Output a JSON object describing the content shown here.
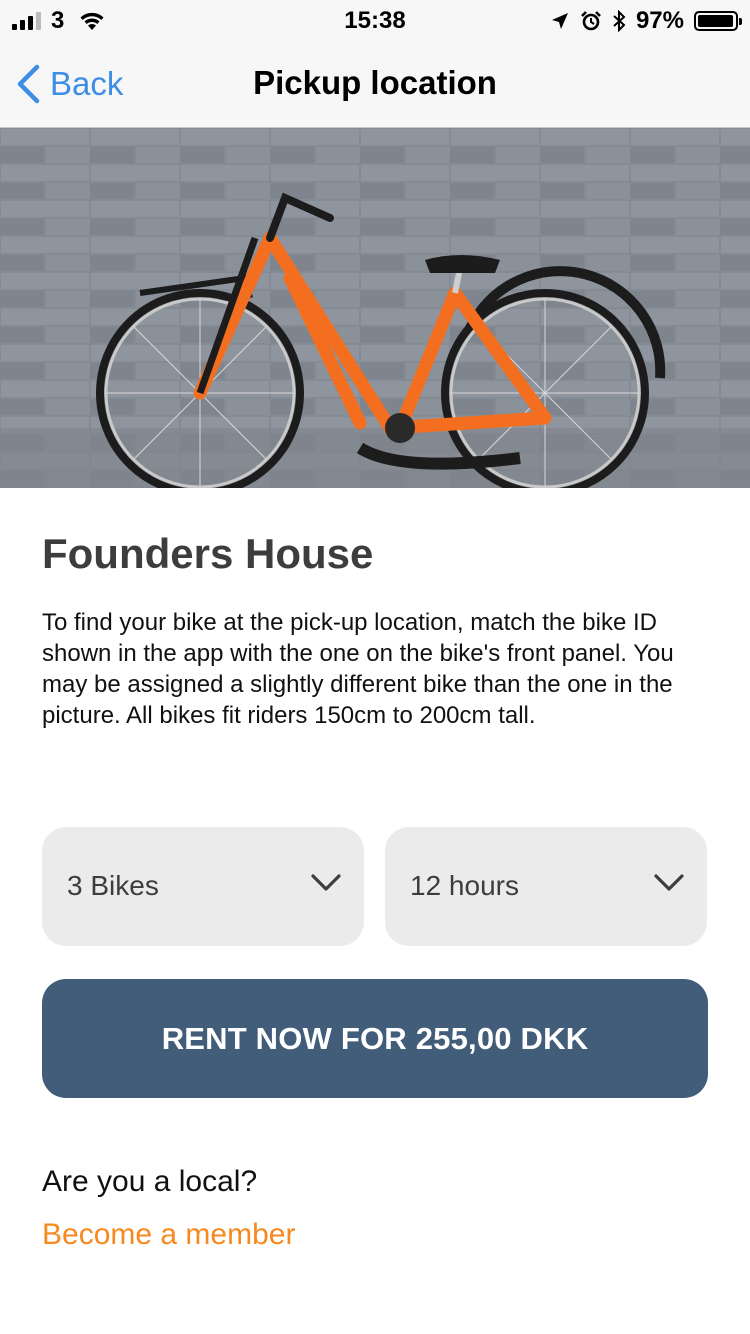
{
  "status_bar": {
    "carrier": "3",
    "time": "15:38",
    "battery_percent": "97%",
    "battery_level": 0.97,
    "icons": [
      "signal-icon",
      "wifi-icon",
      "location-arrow-icon",
      "alarm-icon",
      "bluetooth-icon",
      "battery-icon"
    ]
  },
  "nav": {
    "back_label": "Back",
    "title": "Pickup location"
  },
  "hero": {
    "subject": "bike-photo",
    "colors": {
      "wall": "#8a8f98",
      "frame": "#f36e1f"
    }
  },
  "location": {
    "name": "Founders House",
    "description": "To find your bike at the pick-up location, match the bike ID shown in the app with the one on the bike's front panel. You may be assigned a slightly different bike than the one in the picture. All bikes fit riders 150cm to 200cm tall."
  },
  "selectors": {
    "bikes_value": "3 Bikes",
    "duration_value": "12 hours"
  },
  "rent_button": {
    "label": "RENT NOW FOR 255,00 DKK"
  },
  "membership": {
    "question": "Are you a local?",
    "link_label": "Become a member"
  },
  "colors": {
    "accent_blue": "#3f8ee5",
    "button": "#425d7a",
    "link_orange": "#f7891f",
    "select_bg": "#ebebeb"
  }
}
